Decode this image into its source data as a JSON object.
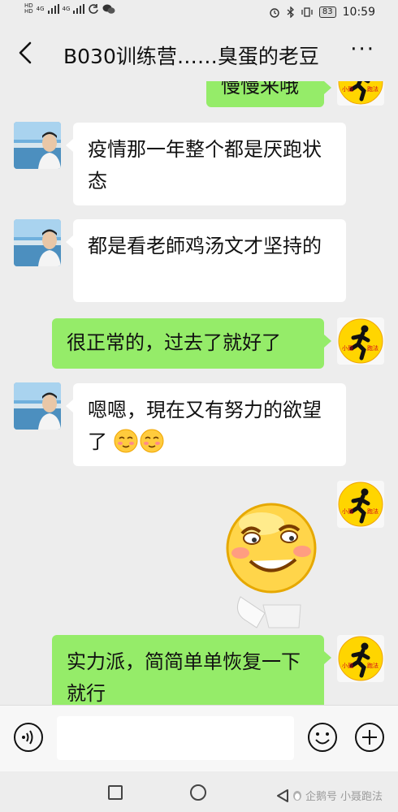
{
  "status_bar": {
    "hd_top": "HD",
    "hd_bottom": "HD",
    "net1": "4G",
    "net2": "4G",
    "battery": "83",
    "time": "10:59"
  },
  "header": {
    "title": "B030训练营……臭蛋的老豆",
    "more": "···"
  },
  "messages": [
    {
      "side": "out",
      "text": "慢慢来哦",
      "partial": true
    },
    {
      "side": "in",
      "text": "疫情那一年整个都是厌跑状态"
    },
    {
      "side": "in",
      "text": "都是看老師鸡汤文才坚持的"
    },
    {
      "side": "out",
      "text": "很正常的，过去了就好了"
    },
    {
      "side": "in",
      "text": "嗯嗯，現在又有努力的欲望了",
      "emojis": [
        "shy-smile-emoji",
        "shy-smile-emoji"
      ]
    },
    {
      "side": "out",
      "type": "sticker",
      "sticker": "grinning-yellow-face-sticker"
    },
    {
      "side": "out",
      "text": "实力派，简简单单恢复一下就行"
    }
  ],
  "avatars": {
    "friend": "friend-avatar",
    "me_logo_text": "小聂跑法"
  },
  "input": {
    "value": "",
    "placeholder": ""
  },
  "watermark": {
    "platform": "企鹅号",
    "account": "小聂跑法"
  },
  "colors": {
    "out_bubble": "#95ec69",
    "in_bubble": "#ffffff",
    "background": "#ededed"
  }
}
